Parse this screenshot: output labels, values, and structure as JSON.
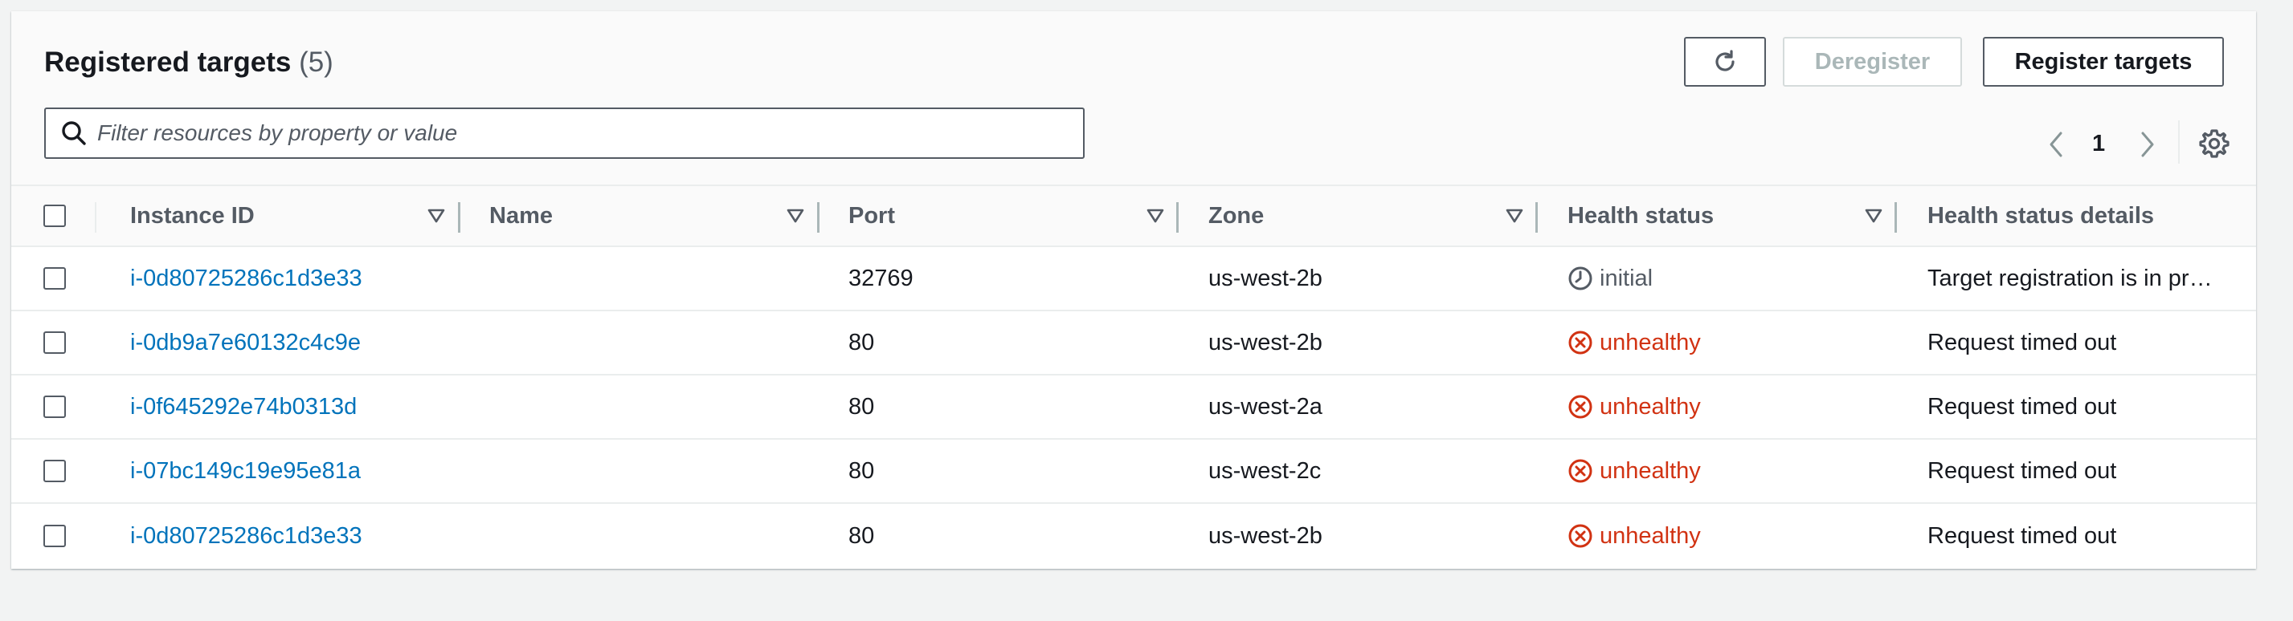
{
  "header": {
    "title": "Registered targets",
    "count": "(5)"
  },
  "buttons": {
    "refresh_icon": "refresh-icon",
    "deregister": "Deregister",
    "register": "Register targets"
  },
  "search": {
    "placeholder": "Filter resources by property or value"
  },
  "pagination": {
    "current_page": "1"
  },
  "table": {
    "columns": [
      "Instance ID",
      "Name",
      "Port",
      "Zone",
      "Health status",
      "Health status details"
    ],
    "rows": [
      {
        "instance_id": "i-0d80725286c1d3e33",
        "name": "",
        "port": "32769",
        "zone": "us-west-2b",
        "health": "initial",
        "details": "Target registration is in pr…"
      },
      {
        "instance_id": "i-0db9a7e60132c4c9e",
        "name": "",
        "port": "80",
        "zone": "us-west-2b",
        "health": "unhealthy",
        "details": "Request timed out"
      },
      {
        "instance_id": "i-0f645292e74b0313d",
        "name": "",
        "port": "80",
        "zone": "us-west-2a",
        "health": "unhealthy",
        "details": "Request timed out"
      },
      {
        "instance_id": "i-07bc149c19e95e81a",
        "name": "",
        "port": "80",
        "zone": "us-west-2c",
        "health": "unhealthy",
        "details": "Request timed out"
      },
      {
        "instance_id": "i-0d80725286c1d3e33",
        "name": "",
        "port": "80",
        "zone": "us-west-2b",
        "health": "unhealthy",
        "details": "Request timed out"
      }
    ]
  },
  "colors": {
    "link": "#0073bb",
    "unhealthy": "#d13212",
    "initial": "#545b64"
  }
}
